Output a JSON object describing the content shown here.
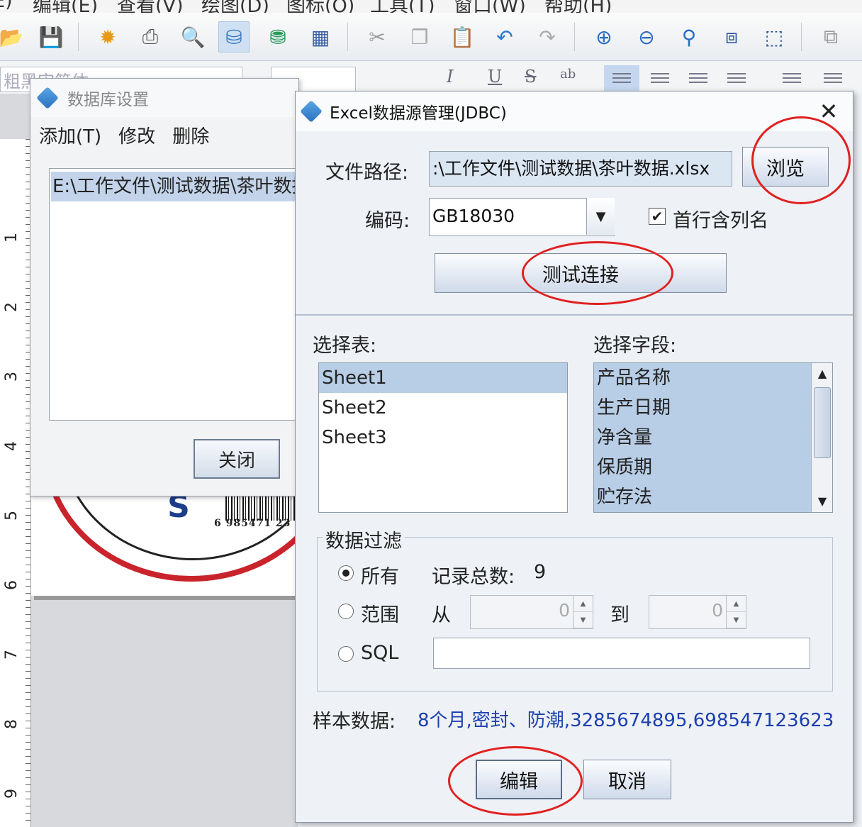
{
  "menubar": {
    "items": [
      "E)",
      "编辑(E)",
      "查看(V)",
      "绘图(D)",
      "图标(O)",
      "工具(T)",
      "窗口(W)",
      "帮助(H)"
    ]
  },
  "toolbar": {
    "icons": [
      "open-icon",
      "save-icon",
      "settings-icon",
      "print-icon",
      "print-preview-icon",
      "database-icon",
      "database-refresh-icon",
      "grid-icon",
      "cut-icon",
      "copy-icon",
      "paste-icon",
      "undo-icon",
      "redo-icon",
      "zoom-in-icon",
      "zoom-out-icon",
      "zoom-icon",
      "fit-page-icon",
      "actual-size-icon",
      "align-icon"
    ]
  },
  "fmtbar": {
    "font": "粗黑宋简体"
  },
  "ruler": {
    "numbers": [
      "1",
      "2",
      "3",
      "4",
      "5",
      "6",
      "7",
      "8",
      "9"
    ]
  },
  "label_preview": {
    "barcode_number": "6 985471 23"
  },
  "db_dialog": {
    "title": "数据库设置",
    "menu": {
      "add": "添加(T)",
      "modify": "修改",
      "delete": "删除"
    },
    "selected_source": "E:\\工作文件\\测试数据\\茶叶数据.xlsx",
    "close_button": "关闭"
  },
  "excel_dialog": {
    "title": "Excel数据源管理(JDBC)",
    "path_label": "文件路径:",
    "path_value": ":\\工作文件\\测试数据\\茶叶数据.xlsx",
    "browse_button": "浏览",
    "encoding_label": "编码:",
    "encoding_value": "GB18030",
    "first_row_header_label": "首行含列名",
    "first_row_header_checked": true,
    "test_button": "测试连接",
    "tables_label": "选择表:",
    "tables": [
      "Sheet1",
      "Sheet2",
      "Sheet3"
    ],
    "selected_table": "Sheet1",
    "fields_label": "选择字段:",
    "fields": [
      "产品名称",
      "生产日期",
      "净含量",
      "保质期",
      "贮存法"
    ],
    "filter": {
      "title": "数据过滤",
      "all_label": "所有",
      "record_count_label": "记录总数:",
      "record_count": "9",
      "range_label": "范围",
      "from_label": "从",
      "from_value": "0",
      "to_label": "到",
      "to_value": "0",
      "sql_label": "SQL",
      "sql_value": "",
      "selected": "all"
    },
    "sample_label": "样本数据:",
    "sample_value": "8个月,密封、防潮,3285674895,698547123623",
    "edit_button": "编辑",
    "cancel_button": "取消"
  },
  "annotation_color": "#e02020"
}
